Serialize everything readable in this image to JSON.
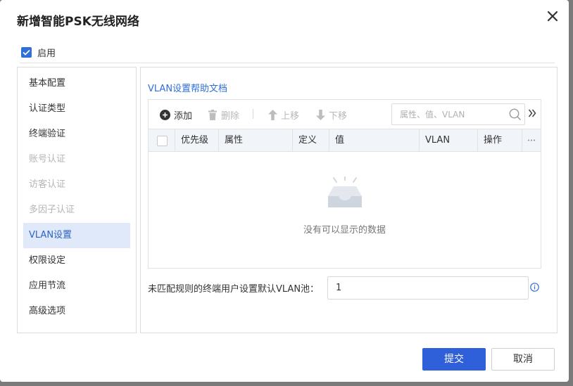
{
  "dialog": {
    "title": "新增智能PSK无线网络",
    "enable_label": "启用",
    "enable_checked": true
  },
  "sidebar": {
    "items": [
      {
        "label": "基本配置",
        "state": "normal"
      },
      {
        "label": "认证类型",
        "state": "normal"
      },
      {
        "label": "终端验证",
        "state": "normal"
      },
      {
        "label": "账号认证",
        "state": "disabled"
      },
      {
        "label": "访客认证",
        "state": "disabled"
      },
      {
        "label": "多因子认证",
        "state": "disabled"
      },
      {
        "label": "VLAN设置",
        "state": "active"
      },
      {
        "label": "权限设定",
        "state": "normal"
      },
      {
        "label": "应用节流",
        "state": "normal"
      },
      {
        "label": "高级选项",
        "state": "normal"
      }
    ]
  },
  "main": {
    "help_link": "VLAN设置帮助文档",
    "toolbar": {
      "add": "添加",
      "delete": "删除",
      "move_up": "上移",
      "move_down": "下移",
      "search_placeholder": "属性、值、VLAN"
    },
    "table": {
      "columns": [
        "优先级",
        "属性",
        "定义",
        "值",
        "VLAN",
        "操作"
      ],
      "rows": [],
      "empty_text": "没有可以显示的数据"
    },
    "default_vlan": {
      "label": "未匹配规则的终端用户设置默认VLAN池：",
      "value": "1"
    }
  },
  "footer": {
    "submit": "提交",
    "cancel": "取消"
  },
  "colors": {
    "accent": "#2f6fd8",
    "submit_bg": "#2f5fd9",
    "active_nav_bg": "#dfe9f9",
    "disabled_text": "#b5b5b5",
    "table_header_bg": "#f1f4f8"
  }
}
